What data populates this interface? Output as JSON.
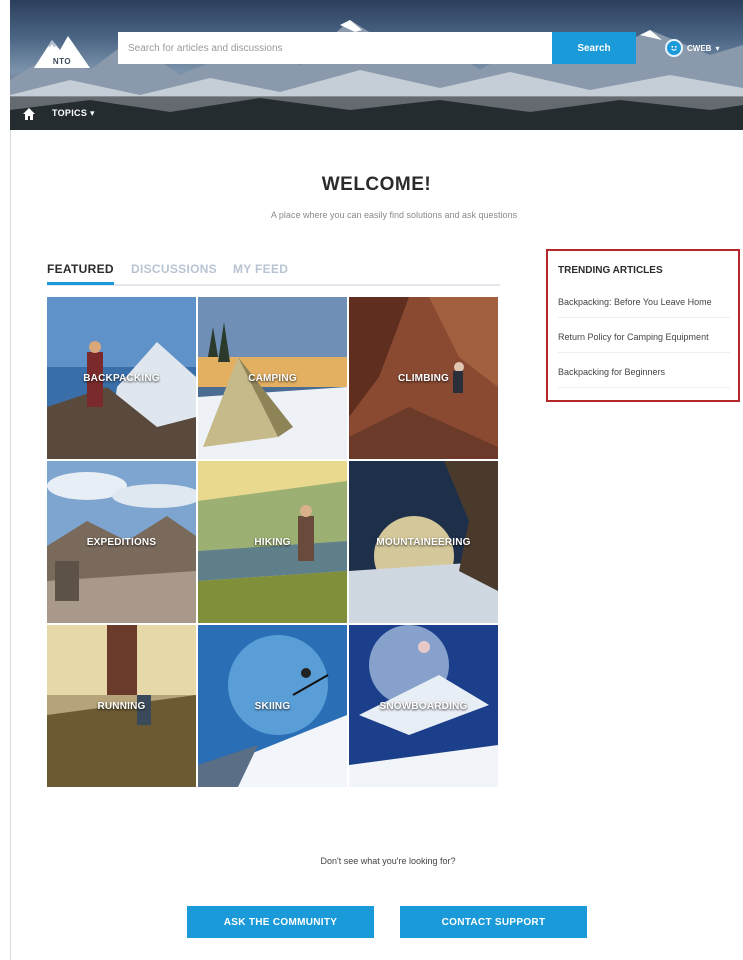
{
  "header": {
    "logo_text": "NTO",
    "search_placeholder": "Search for articles and discussions",
    "search_button": "Search",
    "user_name": "CWEB",
    "user_caret": "▾"
  },
  "nav": {
    "topics_label": "TOPICS",
    "topics_caret": "▾"
  },
  "welcome": {
    "title": "WELCOME!",
    "subtitle": "A place where you can easily find solutions and ask questions"
  },
  "tabs": [
    {
      "label": "FEATURED",
      "active": true
    },
    {
      "label": "DISCUSSIONS",
      "active": false
    },
    {
      "label": "MY FEED",
      "active": false
    }
  ],
  "topics": [
    {
      "label": "BACKPACKING"
    },
    {
      "label": "CAMPING"
    },
    {
      "label": "CLIMBING"
    },
    {
      "label": "EXPEDITIONS"
    },
    {
      "label": "HIKING"
    },
    {
      "label": "MOUNTAINEERING"
    },
    {
      "label": "RUNNING"
    },
    {
      "label": "SKIING"
    },
    {
      "label": "SNOWBOARDING"
    }
  ],
  "trending": {
    "title": "TRENDING ARTICLES",
    "items": [
      "Backpacking: Before You Leave Home",
      "Return Policy for Camping Equipment",
      "Backpacking for Beginners"
    ]
  },
  "footer": {
    "question": "Don't see what you're looking for?",
    "ask_button": "ASK THE COMMUNITY",
    "contact_button": "CONTACT SUPPORT"
  },
  "colors": {
    "accent": "#1b9ad9",
    "highlight_border": "#b3262a"
  }
}
